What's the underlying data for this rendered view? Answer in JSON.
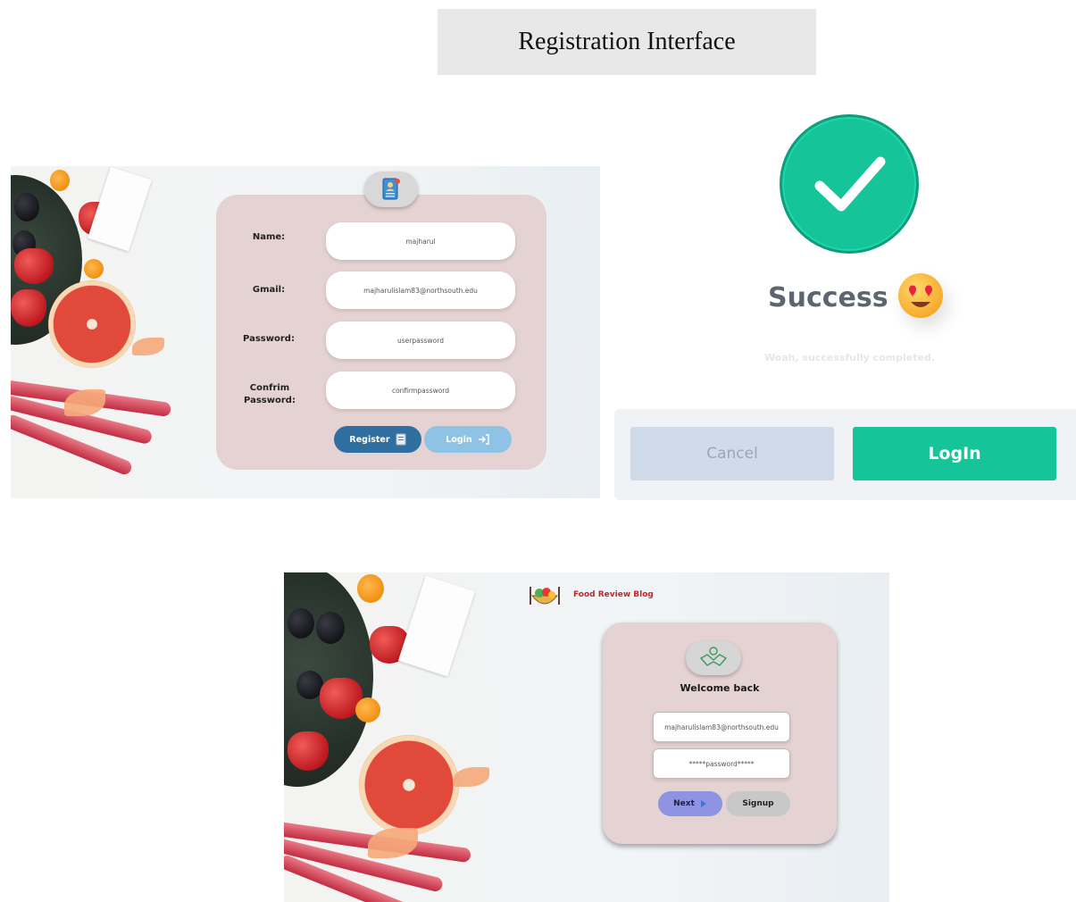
{
  "page_title": "Registration Interface",
  "registration": {
    "fields": [
      {
        "label": "Name:",
        "value": "majharul"
      },
      {
        "label": "Gmail:",
        "value": "majharulislam83@northsouth.edu"
      },
      {
        "label": "Password:",
        "value": "userpassword"
      },
      {
        "label": "Confrim Password:",
        "value": "confirmpassword"
      }
    ],
    "register_label": "Register",
    "login_label": "Login",
    "colors": {
      "card": "#e5d2d2",
      "register": "#2f6ea1",
      "login": "#8fc3e6"
    }
  },
  "success": {
    "title": "Success",
    "subtitle": "Woah, successfully completed.",
    "cancel_label": "Cancel",
    "login_label": "LogIn",
    "colors": {
      "accent": "#16c49a",
      "cancel": "#cfdbe8"
    }
  },
  "login": {
    "brand": "Food Review Blog",
    "welcome": "Welcome back",
    "email_value": "majharulislam83@northsouth.edu",
    "password_value": "*****password*****",
    "next_label": "Next",
    "signup_label": "Signup",
    "colors": {
      "next": "#8e93e3",
      "signup": "#c8c8c8"
    }
  }
}
